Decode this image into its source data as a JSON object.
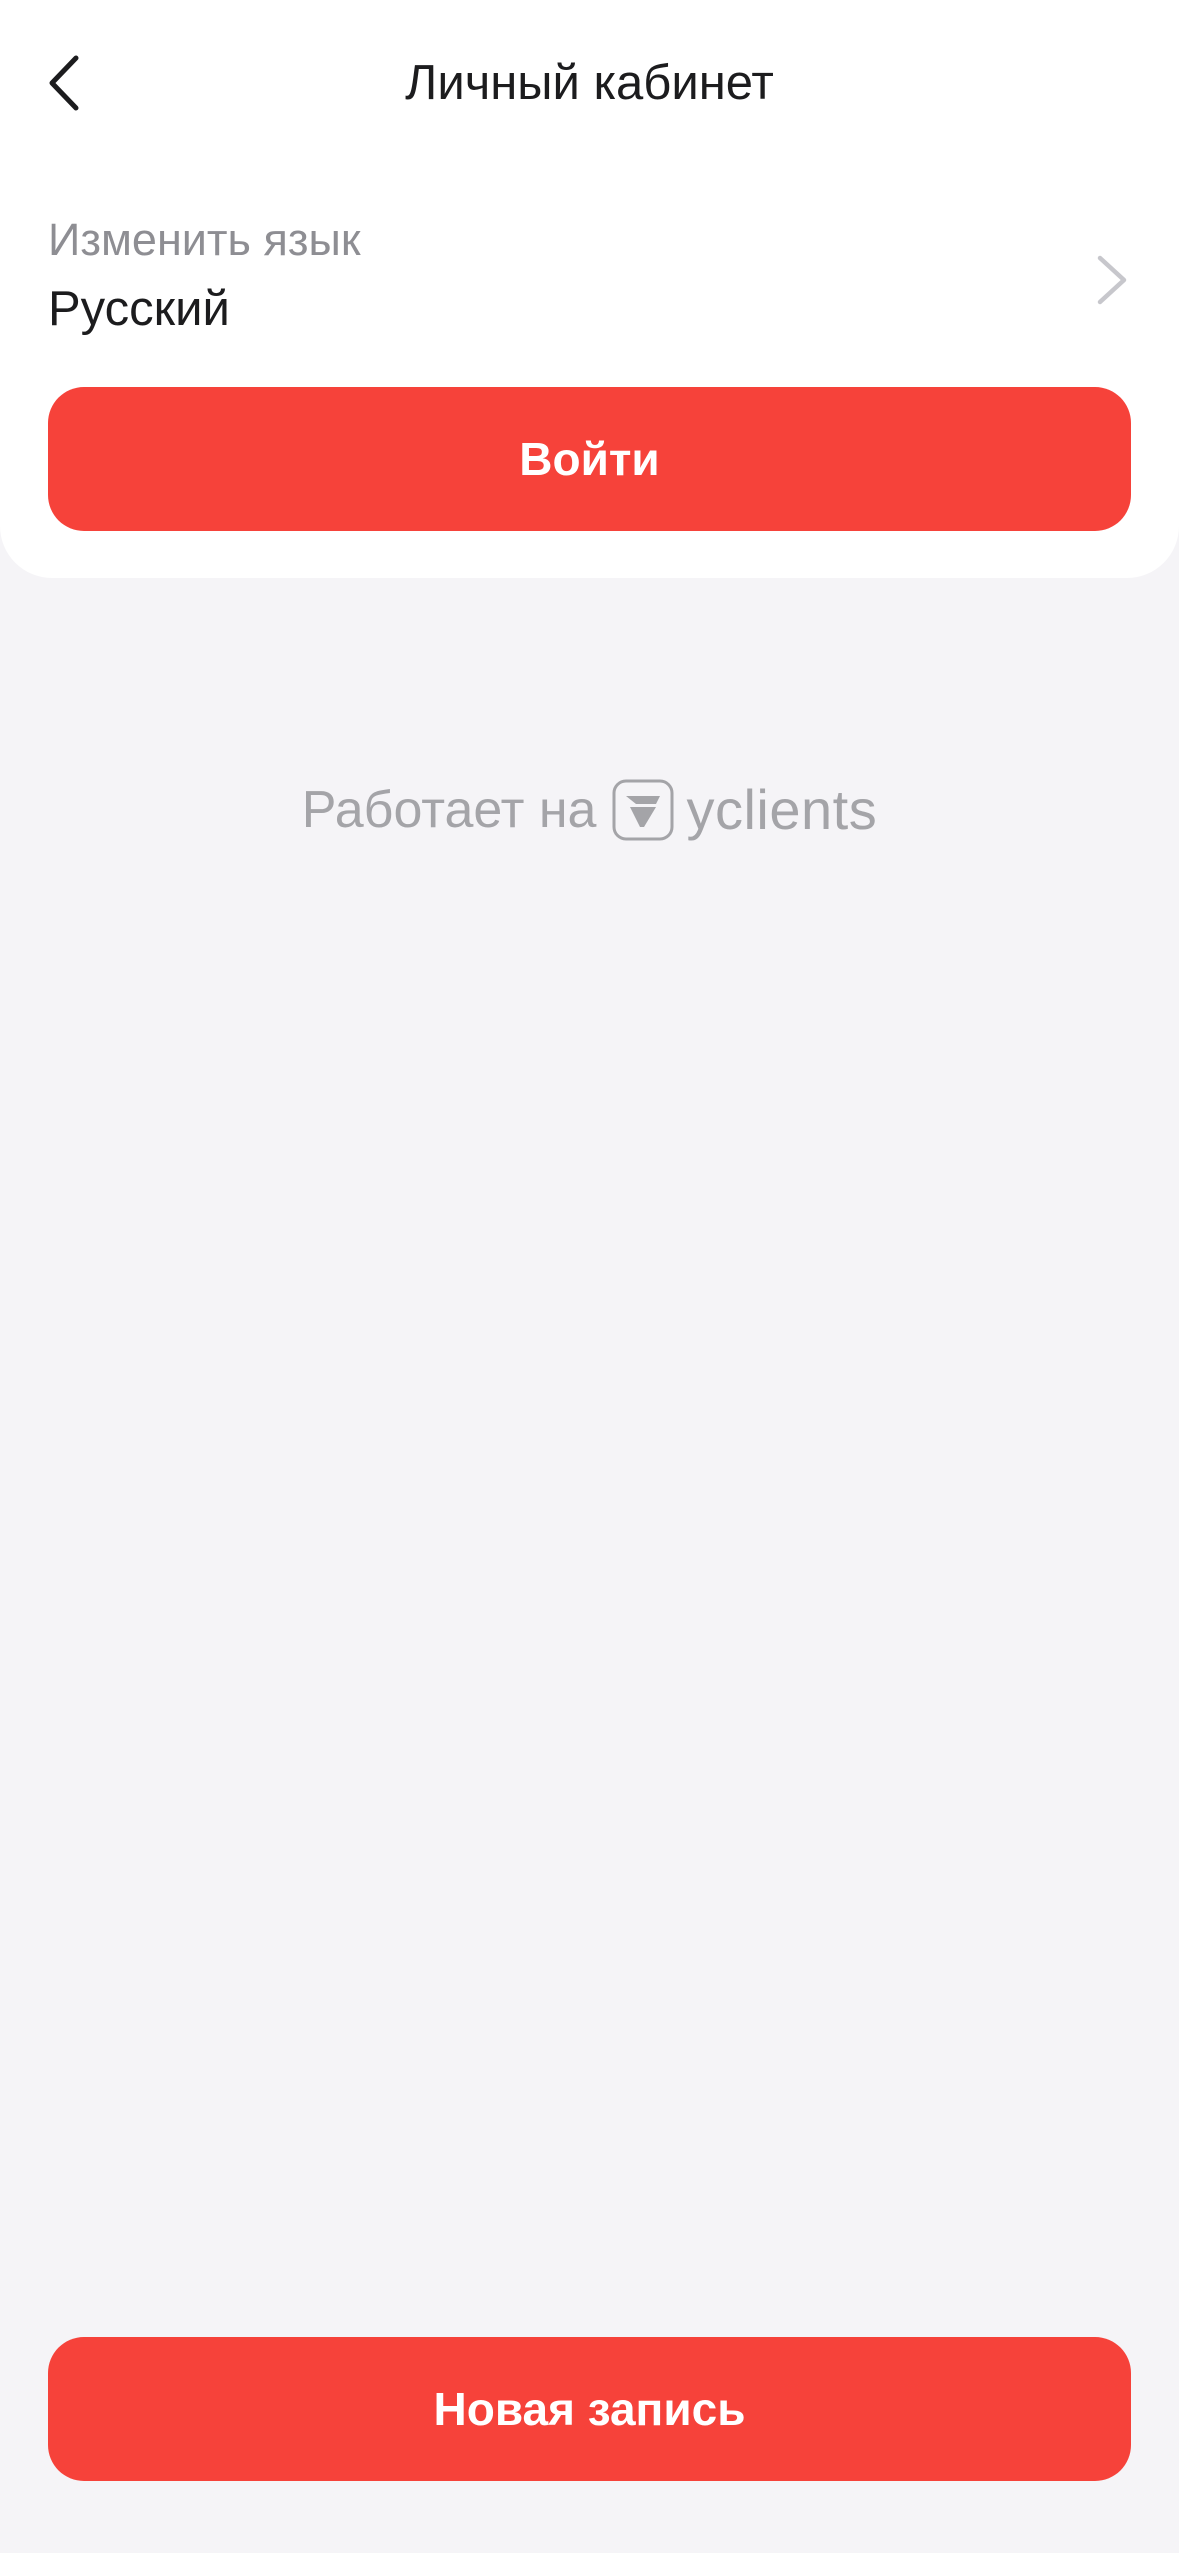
{
  "header": {
    "title": "Личный кабинет",
    "back_icon": "chevron-left-icon"
  },
  "language": {
    "label": "Изменить язык",
    "value": "Русский",
    "chevron_icon": "chevron-right-icon"
  },
  "login_button": {
    "label": "Войти"
  },
  "powered_by": {
    "text": "Работает на",
    "brand": "yclients",
    "logo_icon": "yclients-logo-icon"
  },
  "new_booking_button": {
    "label": "Новая запись"
  },
  "colors": {
    "accent": "#f6423a",
    "background": "#f5f4f7",
    "card": "#ffffff",
    "text_primary": "#1c1c1e",
    "text_secondary": "#8e8e93",
    "text_muted": "#a4a4a8"
  }
}
